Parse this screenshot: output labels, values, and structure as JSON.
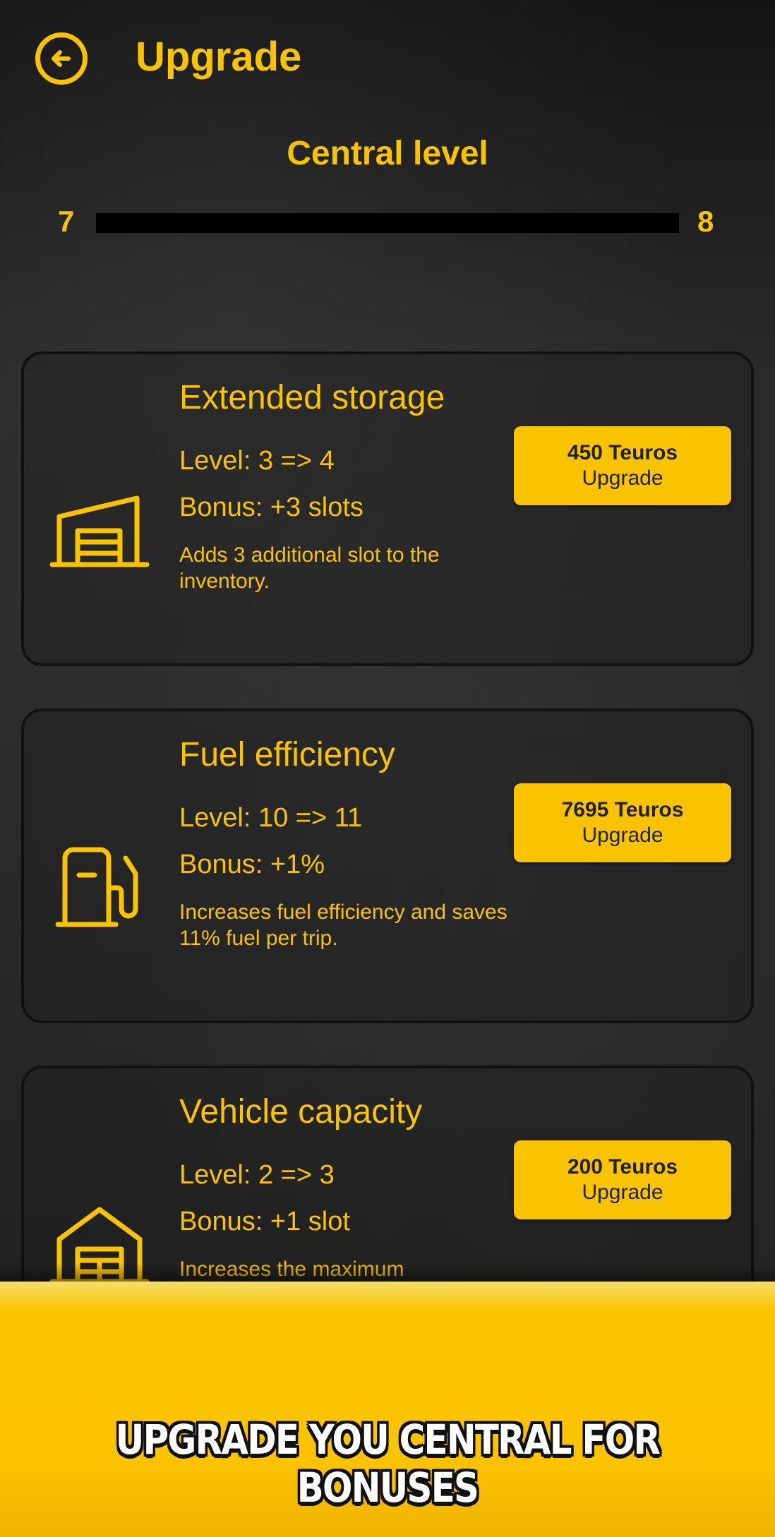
{
  "header": {
    "title": "Upgrade"
  },
  "central": {
    "label": "Central level",
    "level_from": "7",
    "level_to": "8",
    "progress": 0
  },
  "upgrades": [
    {
      "title": "Extended storage",
      "level": "Level: 3 => 4",
      "bonus": "Bonus: +3 slots",
      "description": "Adds 3 additional slot to the inventory.",
      "price": "450 Teuros",
      "action": "Upgrade",
      "icon": "warehouse-icon"
    },
    {
      "title": "Fuel efficiency",
      "level": "Level: 10 => 11",
      "bonus": "Bonus: +1%",
      "description": "Increases fuel efficiency and saves 11% fuel per trip.",
      "price": "7695 Teuros",
      "action": "Upgrade",
      "icon": "fuel-pump-icon"
    },
    {
      "title": "Vehicle capacity",
      "level": "Level: 2 => 3",
      "bonus": "Bonus: +1 slot",
      "description": "Increases the maximum",
      "price": "200 Teuros",
      "action": "Upgrade",
      "icon": "garage-icon"
    }
  ],
  "banner": {
    "text": "UPGRADE YOU CENTRAL FOR BONUSES"
  },
  "colors": {
    "accent": "#f9c300",
    "background": "#1f1f1f",
    "button_text": "#222222"
  }
}
